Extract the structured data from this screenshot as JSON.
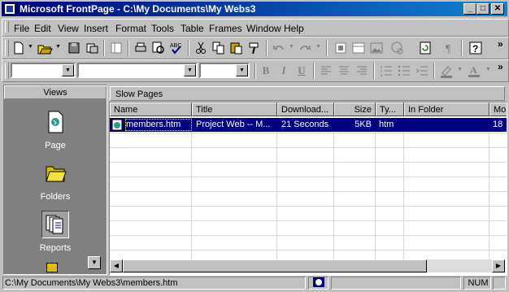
{
  "window": {
    "title": "Microsoft FrontPage - C:\\My Documents\\My Webs3"
  },
  "menu": [
    "File",
    "Edit",
    "View",
    "Insert",
    "Format",
    "Tools",
    "Table",
    "Frames",
    "Window",
    "Help"
  ],
  "views": {
    "header": "Views",
    "items": [
      {
        "label": "Page",
        "icon": "page-view-icon"
      },
      {
        "label": "Folders",
        "icon": "folder-icon"
      },
      {
        "label": "Reports",
        "icon": "reports-icon"
      }
    ]
  },
  "report": {
    "title": "Slow Pages",
    "columns": [
      "Name",
      "Title",
      "Download...",
      "Size",
      "Ty...",
      "In Folder",
      "Mo"
    ],
    "rows": [
      {
        "name": "members.htm",
        "title": "Project Web -- M...",
        "download": "21 Seconds",
        "size": "5KB",
        "type": "htm",
        "folder": "",
        "modified": "18"
      }
    ]
  },
  "status": {
    "path": "C:\\My Documents\\My Webs3\\members.htm",
    "num": "NUM"
  },
  "colors": {
    "title_start": "#000080",
    "title_end": "#1084d0",
    "selection": "#000080",
    "panel": "#808080",
    "chrome": "#c0c0c0"
  }
}
